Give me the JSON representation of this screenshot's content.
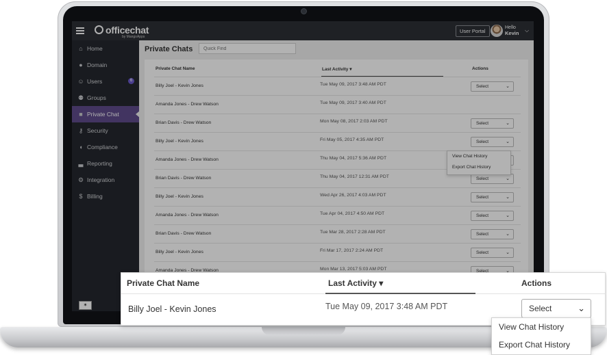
{
  "app": {
    "logo_text": "officechat",
    "logo_sub": "by MangoApps",
    "user_portal": "User Portal",
    "hello": "Hello",
    "user_name": "Kevin"
  },
  "sidebar": {
    "items": [
      {
        "label": "Home",
        "icon": "home-icon"
      },
      {
        "label": "Domain",
        "icon": "globe-icon"
      },
      {
        "label": "Users",
        "icon": "user-icon",
        "badge": "6"
      },
      {
        "label": "Groups",
        "icon": "groups-icon"
      },
      {
        "label": "Private Chat",
        "icon": "chat-bubbles-icon",
        "active": true
      },
      {
        "label": "Security",
        "icon": "key-icon"
      },
      {
        "label": "Compliance",
        "icon": "shield-icon"
      },
      {
        "label": "Reporting",
        "icon": "bar-chart-icon"
      },
      {
        "label": "Integration",
        "icon": "gear-icon"
      },
      {
        "label": "Billing",
        "icon": "dollar-icon"
      }
    ]
  },
  "page": {
    "title": "Private Chats",
    "quick_find_placeholder": "Quick Find"
  },
  "table": {
    "columns": [
      "Private Chat Name",
      "Last Activity",
      "Actions"
    ],
    "select_label": "Select",
    "rows": [
      {
        "name": "Billy Joel - Kevin Jones",
        "date": "Tue May 09, 2017 3:48 AM PDT"
      },
      {
        "name": "Amanda Jones - Drew Watson",
        "date": "Tue May 09, 2017 3:40 AM PDT"
      },
      {
        "name": "Brian Davis - Drew Watson",
        "date": "Mon May 08, 2017 2:03 AM PDT"
      },
      {
        "name": "Billy Joel - Kevin Jones",
        "date": "Fri May 05, 2017 4:35 AM PDT"
      },
      {
        "name": "Amanda Jones - Drew Watson",
        "date": "Thu May 04, 2017 5:36 AM PDT"
      },
      {
        "name": "Brian Davis - Drew Watson",
        "date": "Thu May 04, 2017 12:31 AM PDT"
      },
      {
        "name": "Billy Joel - Kevin Jones",
        "date": "Wed Apr 26, 2017 4:03 AM PDT"
      },
      {
        "name": "Amanda Jones - Drew Watson",
        "date": "Tue Apr 04, 2017 4:50 AM PDT"
      },
      {
        "name": "Brian Davis - Drew Watson",
        "date": "Tue Mar 28, 2017 2:28 AM PDT"
      },
      {
        "name": "Billy Joel - Kevin Jones",
        "date": "Fri Mar 17, 2017 2:24 AM PDT"
      },
      {
        "name": "Amanda Jones - Drew Watson",
        "date": "Mon Mar 13, 2017 5:03 AM PDT"
      }
    ],
    "dropdown_options": [
      "View Chat History",
      "Export Chat History"
    ]
  },
  "callout": {
    "row_name": "Billy Joel - Kevin Jones",
    "row_date": "Tue May 09, 2017 3:48 AM PDT"
  }
}
